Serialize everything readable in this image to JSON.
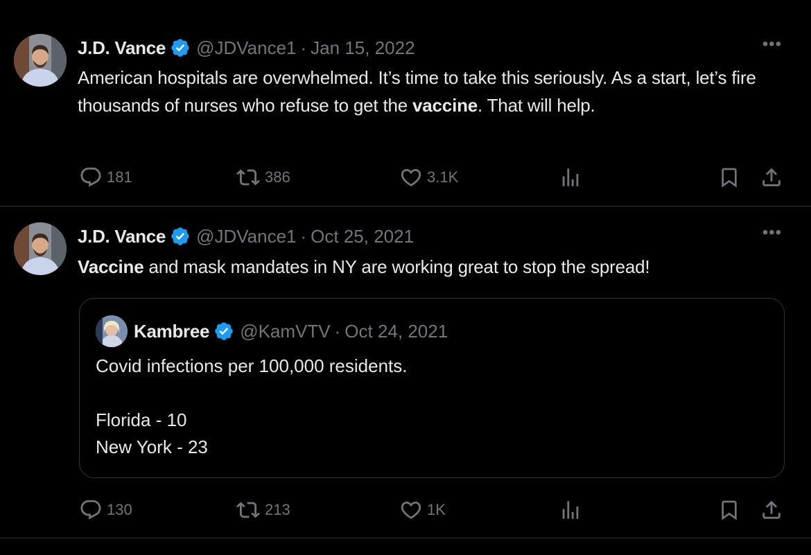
{
  "tweets": [
    {
      "author": {
        "name": "J.D. Vance",
        "handle": "@JDVance1"
      },
      "date": "Jan 15, 2022",
      "text_parts": [
        {
          "text": "American hospitals are overwhelmed. It’s time to take this seriously.  As a start, let’s fire thousands of nurses who refuse to get the "
        },
        {
          "text": "vaccine",
          "bold": true
        },
        {
          "text": ". That will help."
        }
      ],
      "stats": {
        "replies": "181",
        "reposts": "386",
        "likes": "3.1K"
      }
    },
    {
      "author": {
        "name": "J.D. Vance",
        "handle": "@JDVance1"
      },
      "date": "Oct 25, 2021",
      "text_parts": [
        {
          "text": "Vaccine",
          "bold": true
        },
        {
          "text": " and mask mandates in NY are working great to stop the spread!"
        }
      ],
      "quote": {
        "author": {
          "name": "Kambree",
          "handle": "@KamVTV"
        },
        "date": "Oct 24, 2021",
        "lines": [
          "Covid infections per 100,000 residents.",
          "",
          "Florida -  10",
          "New York - 23"
        ]
      },
      "stats": {
        "replies": "130",
        "reposts": "213",
        "likes": "1K"
      }
    }
  ],
  "separator": "·",
  "more_label": "•••",
  "colors": {
    "background": "#000000",
    "text": "#e7e9ea",
    "muted": "#71767b",
    "border": "#2f3336",
    "verified": "#1d9bf0"
  }
}
